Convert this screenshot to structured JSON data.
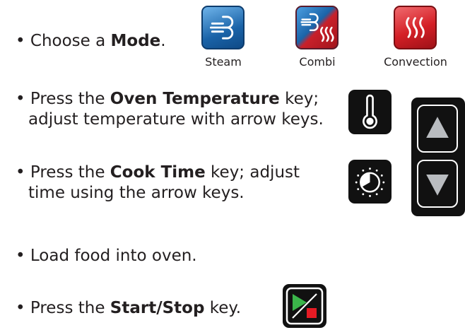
{
  "steps": {
    "mode": {
      "bullet": "•",
      "pre": "Choose a ",
      "bold": "Mode",
      "post": "."
    },
    "temp": {
      "bullet": "•",
      "pre": "Press the ",
      "bold": "Oven Temperature",
      "post": " key;",
      "line2": "adjust temperature with arrow keys."
    },
    "time": {
      "bullet": "•",
      "pre": "Press the ",
      "bold": "Cook Time",
      "post": " key; adjust",
      "line2": "time using the arrow keys."
    },
    "load": {
      "bullet": "•",
      "text": "Load food into oven."
    },
    "start": {
      "bullet": "•",
      "pre": "Press the ",
      "bold": "Start/Stop",
      "post": " key."
    }
  },
  "modes": [
    {
      "label": "Steam",
      "icon": "steam-icon",
      "color": "#1b6fb3"
    },
    {
      "label": "Combi",
      "icon": "combi-icon",
      "color": "#c8202a"
    },
    {
      "label": "Convection",
      "icon": "convection-icon",
      "color": "#d41f26"
    }
  ],
  "icons": {
    "temperature": "thermometer-icon",
    "time": "timer-dial-icon",
    "up": "up-arrow-icon",
    "down": "down-arrow-icon",
    "start": "start-stop-icon"
  }
}
